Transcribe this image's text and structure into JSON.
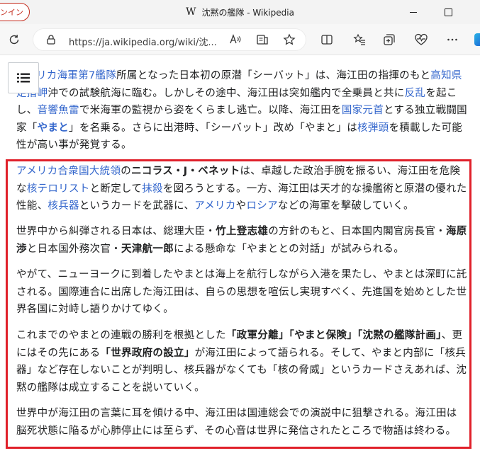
{
  "browser": {
    "signin_label": "インイン",
    "logo_text": "W",
    "tab_title": "沈黙の艦隊 - Wikipedia",
    "url": "https://ja.wikipedia.org/wiki/沈...",
    "icons": [
      "refresh-icon",
      "site-info-icon",
      "read-aloud-icon",
      "immersive-reader-icon",
      "favorite-star-icon",
      "split-screen-icon",
      "favorites-icon",
      "collections-icon",
      "browser-essentials-icon",
      "copilot-icon",
      "minimize-icon",
      "maximize-icon"
    ]
  },
  "article": {
    "menu_icon": "table-of-contents-icon",
    "paragraphs": [
      [
        {
          "t": "リカ海軍第7艦隊",
          "link": true
        },
        {
          "t": "所属となった日本初の原潜「シーバット」は、海江田の指揮のもと"
        },
        {
          "t": "高知県足摺岬",
          "link": true
        },
        {
          "t": "沖での試験航海に臨む。しかしその途中、海江田は突如艦内で全乗員と共に"
        },
        {
          "t": "反乱",
          "link": true
        },
        {
          "t": "を起こし、"
        },
        {
          "t": "音響魚雷",
          "link": true
        },
        {
          "t": "で米海軍の監視から姿をくらまし逃亡。以降、海江田を"
        },
        {
          "t": "国家元首",
          "link": true
        },
        {
          "t": "とする独立戦闘国家「"
        },
        {
          "t": "やまと",
          "link": true,
          "bold": true
        },
        {
          "t": "」を名乗る。さらに出港時、「シーバット」改め「やまと」は"
        },
        {
          "t": "核弾頭",
          "link": true
        },
        {
          "t": "を積載した可能性が高い事が発覚する。"
        }
      ],
      [
        {
          "t": "アメリカ合衆国大統領",
          "link": true
        },
        {
          "t": "の"
        },
        {
          "t": "ニコラス・J・ベネット",
          "bold": true
        },
        {
          "t": "は、卓越した政治手腕を振るい、海江田を危険な"
        },
        {
          "t": "核テロリスト",
          "link": true
        },
        {
          "t": "と断定して"
        },
        {
          "t": "抹殺",
          "link": true
        },
        {
          "t": "を図ろうとする。一方、海江田は天才的な操艦術と原潜の優れた性能、"
        },
        {
          "t": "核兵器",
          "link": true
        },
        {
          "t": "というカードを武器に、"
        },
        {
          "t": "アメリカ",
          "link": true
        },
        {
          "t": "や"
        },
        {
          "t": "ロシア",
          "link": true
        },
        {
          "t": "などの海軍を撃破していく。"
        }
      ],
      [
        {
          "t": "世界中から糾弾される日本は、総理大臣・"
        },
        {
          "t": "竹上登志雄",
          "bold": true
        },
        {
          "t": "の方針のもと、日本国内閣官房長官・"
        },
        {
          "t": "海原渉",
          "bold": true
        },
        {
          "t": "と日本国外務次官・"
        },
        {
          "t": "天津航一郎",
          "bold": true
        },
        {
          "t": "による懸命な「やまととの対話」が試みられる。"
        }
      ],
      [
        {
          "t": "やがて、ニューヨークに到着したやまとは海上を航行しながら入港を果たし、やまとは深町に託される。国際連合に出席した海江田は、自らの思想を喧伝し実現すべく、先進国を始めとした世界各国に対峙し語りかけてゆく。"
        }
      ],
      [
        {
          "t": "これまでのやまとの連戦の勝利を根拠とした"
        },
        {
          "t": "「政軍分離」「やまと保険」「沈黙の艦隊計画」",
          "bold": true
        },
        {
          "t": "、更にはその先にある"
        },
        {
          "t": "「世界政府の設立」",
          "bold": true
        },
        {
          "t": "が海江田によって語られる。そして、やまと内部に「核兵器」など存在しないことが判明し、核兵器がなくても「核の脅威」というカードさえあれば、沈黙の艦隊は成立することを説いていく。"
        }
      ],
      [
        {
          "t": "世界中が海江田の言葉に耳を傾ける中、海江田は国連総会での演説中に狙撃される。海江田は脳死状態に陥るが心肺停止には至らず、その心音は世界に発信されたところで物語は終わる。"
        }
      ]
    ]
  },
  "colors": {
    "link": "#3366cc",
    "text": "#202122",
    "highlight_border": "#e0202a",
    "signin_red": "#c42b1c"
  }
}
